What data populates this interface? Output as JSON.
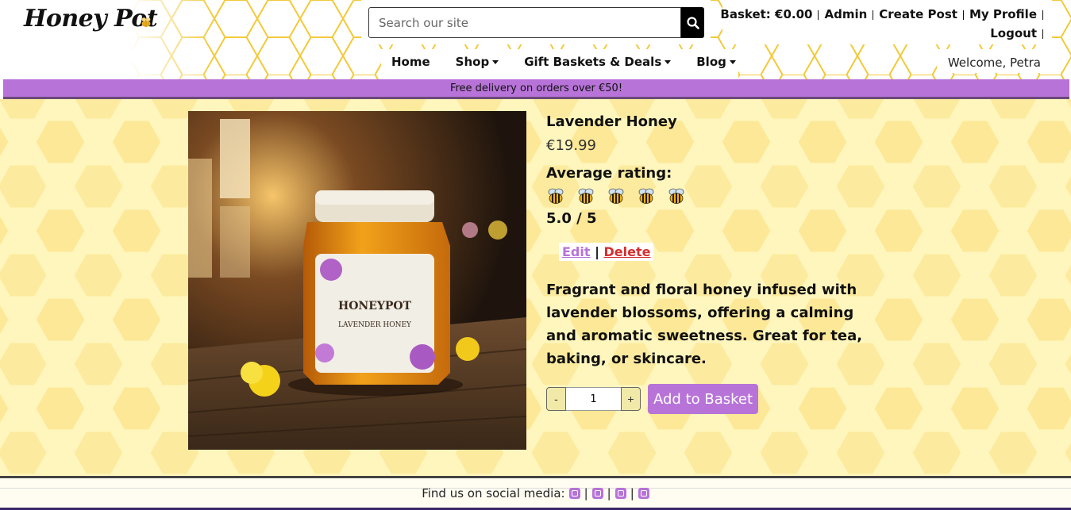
{
  "header": {
    "logo_text": "Honey Pot",
    "search": {
      "placeholder": "Search our site"
    },
    "account_links": [
      "Basket: €0.00",
      "Admin",
      "Create Post",
      "My Profile",
      "Logout"
    ],
    "nav": [
      {
        "label": "Home",
        "dropdown": false
      },
      {
        "label": "Shop",
        "dropdown": true
      },
      {
        "label": "Gift Baskets & Deals",
        "dropdown": true
      },
      {
        "label": "Blog",
        "dropdown": true
      }
    ],
    "welcome": "Welcome, Petra"
  },
  "banner": {
    "text": "Free delivery on orders over €50!"
  },
  "product": {
    "title": "Lavender Honey",
    "price": "€19.99",
    "rating_label": "Average rating:",
    "rating_value": 5,
    "rating_icon": "bee-icon",
    "rating_text": "5.0 / 5",
    "edit_label": "Edit",
    "delete_label": "Delete",
    "separator": "|",
    "description": "Fragrant and floral honey infused with lavender blossoms, offering a calming and aromatic sweetness. Great for tea, baking, or skincare.",
    "quantity": "1",
    "minus_label": "-",
    "plus_label": "+",
    "add_to_basket_label": "Add to Basket",
    "image": {
      "jar_brand": "HONEYPOT",
      "jar_label": "LAVENDER HONEY"
    }
  },
  "footer": {
    "social_label": "Find us on social media:",
    "social_icons": [
      "github-icon",
      "facebook-icon",
      "youtube-icon",
      "instagram-icon"
    ]
  },
  "colors": {
    "accent": "#b773d8",
    "delete": "#d32f2f",
    "main_bg": "#fff6bd",
    "hex_stroke": "#f3c93a"
  }
}
